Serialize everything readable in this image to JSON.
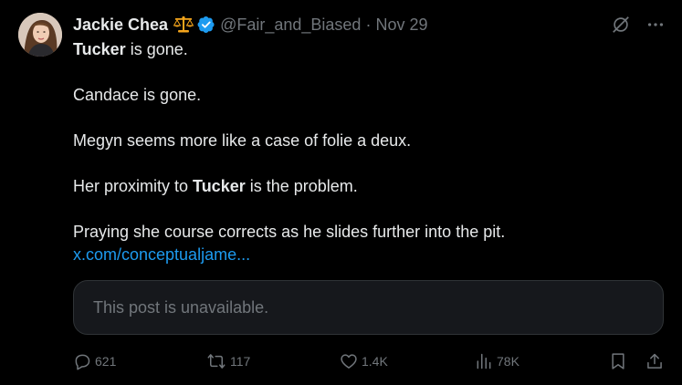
{
  "author": {
    "name": "Jackie Chea",
    "handle": "@Fair_and_Biased",
    "date": "Nov 29",
    "separator": "·",
    "badge_icon": "scales-emoji-icon",
    "verified_icon": "verified-badge-icon"
  },
  "post": {
    "p1_bold": "Tucker",
    "p1_rest": " is gone.",
    "p2": "Candace is gone.",
    "p3": "Megyn seems more like a case of folie a deux.",
    "p4_start": "Her proximity to ",
    "p4_bold": "Tucker",
    "p4_end": " is the problem.",
    "p5_text": "Praying she course corrects as he slides further into the pit. ",
    "p5_link": "x.com/conceptualjame..."
  },
  "quote": {
    "text": "This post is unavailable."
  },
  "actions": {
    "replies": "621",
    "reposts": "117",
    "likes": "1.4K",
    "views": "78K"
  },
  "colors": {
    "background": "#000000",
    "text": "#e7e9ea",
    "muted": "#71767b",
    "link": "#1d9bf0",
    "verified": "#1d9bf0",
    "quote_bg": "#16181c"
  }
}
